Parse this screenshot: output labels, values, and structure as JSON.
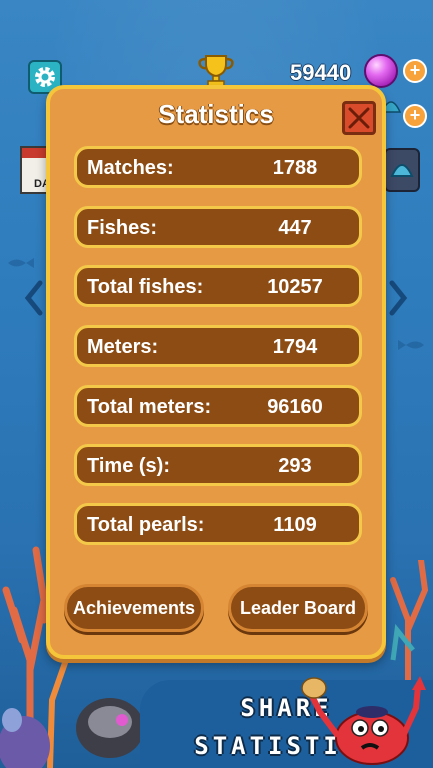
{
  "header": {
    "pearl_count": "59440",
    "plus_label": "+"
  },
  "left_card": {
    "label": "DA"
  },
  "modal": {
    "title": "Statistics",
    "stats": [
      {
        "label": "Matches:",
        "value": "1788"
      },
      {
        "label": "Fishes:",
        "value": "447"
      },
      {
        "label": "Total fishes:",
        "value": "10257"
      },
      {
        "label": "Meters:",
        "value": "1794"
      },
      {
        "label": "Total meters:",
        "value": "96160"
      },
      {
        "label": "Time (s):",
        "value": "293"
      },
      {
        "label": "Total pearls:",
        "value": "1109"
      }
    ],
    "achievements_label": "Achievements",
    "leaderboard_label": "Leader Board"
  },
  "share": {
    "line1": "SHARE",
    "line2": "STATISTICS"
  },
  "colors": {
    "modal_bg": "#e79a44",
    "modal_border": "#f6c63a",
    "row_bg": "#8c4c14",
    "close_bg": "#d94b2a"
  },
  "icons": [
    "gear-icon",
    "trophy-icon",
    "pearl-icon",
    "plus-icon",
    "close-icon",
    "chevron-left-icon",
    "chevron-right-icon",
    "shell-icon",
    "crab-icon",
    "calendar-icon"
  ]
}
